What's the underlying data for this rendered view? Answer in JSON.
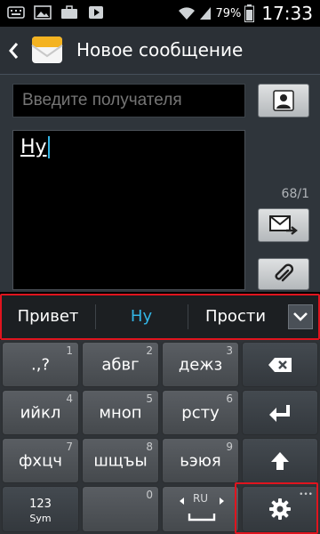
{
  "status_bar": {
    "icons": [
      "keyboard-icon",
      "image-icon",
      "briefcase-icon",
      "play-store-icon",
      "wifi-icon",
      "signal-icon",
      "battery-icon"
    ],
    "battery": "79%",
    "time": "17:33"
  },
  "header": {
    "title": "Новое сообщение",
    "back_icon": "chevron-left-icon",
    "app_icon": "message-envelope-icon"
  },
  "compose": {
    "recipient_placeholder": "Введите получателя",
    "message_text": "Ну",
    "counter": "68/1"
  },
  "suggestions": {
    "items": [
      "Привет",
      "Ну",
      "Прости"
    ],
    "selected": "Ну",
    "expand_icon": "chevron-down-icon"
  },
  "keyboard": {
    "row1": [
      {
        "label": ".,?",
        "num": "1"
      },
      {
        "label": "абвг",
        "num": "2"
      },
      {
        "label": "дежз",
        "num": "3"
      }
    ],
    "row2": [
      {
        "label": "ийкл",
        "num": "4"
      },
      {
        "label": "мноп",
        "num": "5"
      },
      {
        "label": "рсту",
        "num": "6"
      }
    ],
    "row3": [
      {
        "label": "фхцч",
        "num": "7"
      },
      {
        "label": "шщъы",
        "num": "8"
      },
      {
        "label": "ьэюя",
        "num": "9"
      }
    ],
    "sym_key": {
      "top": "123",
      "bottom": "Sym"
    },
    "space_key": {
      "num": "0",
      "lang": "RU"
    }
  },
  "colors": {
    "accent": "#33b5e5",
    "highlight_border": "#e0141e"
  }
}
